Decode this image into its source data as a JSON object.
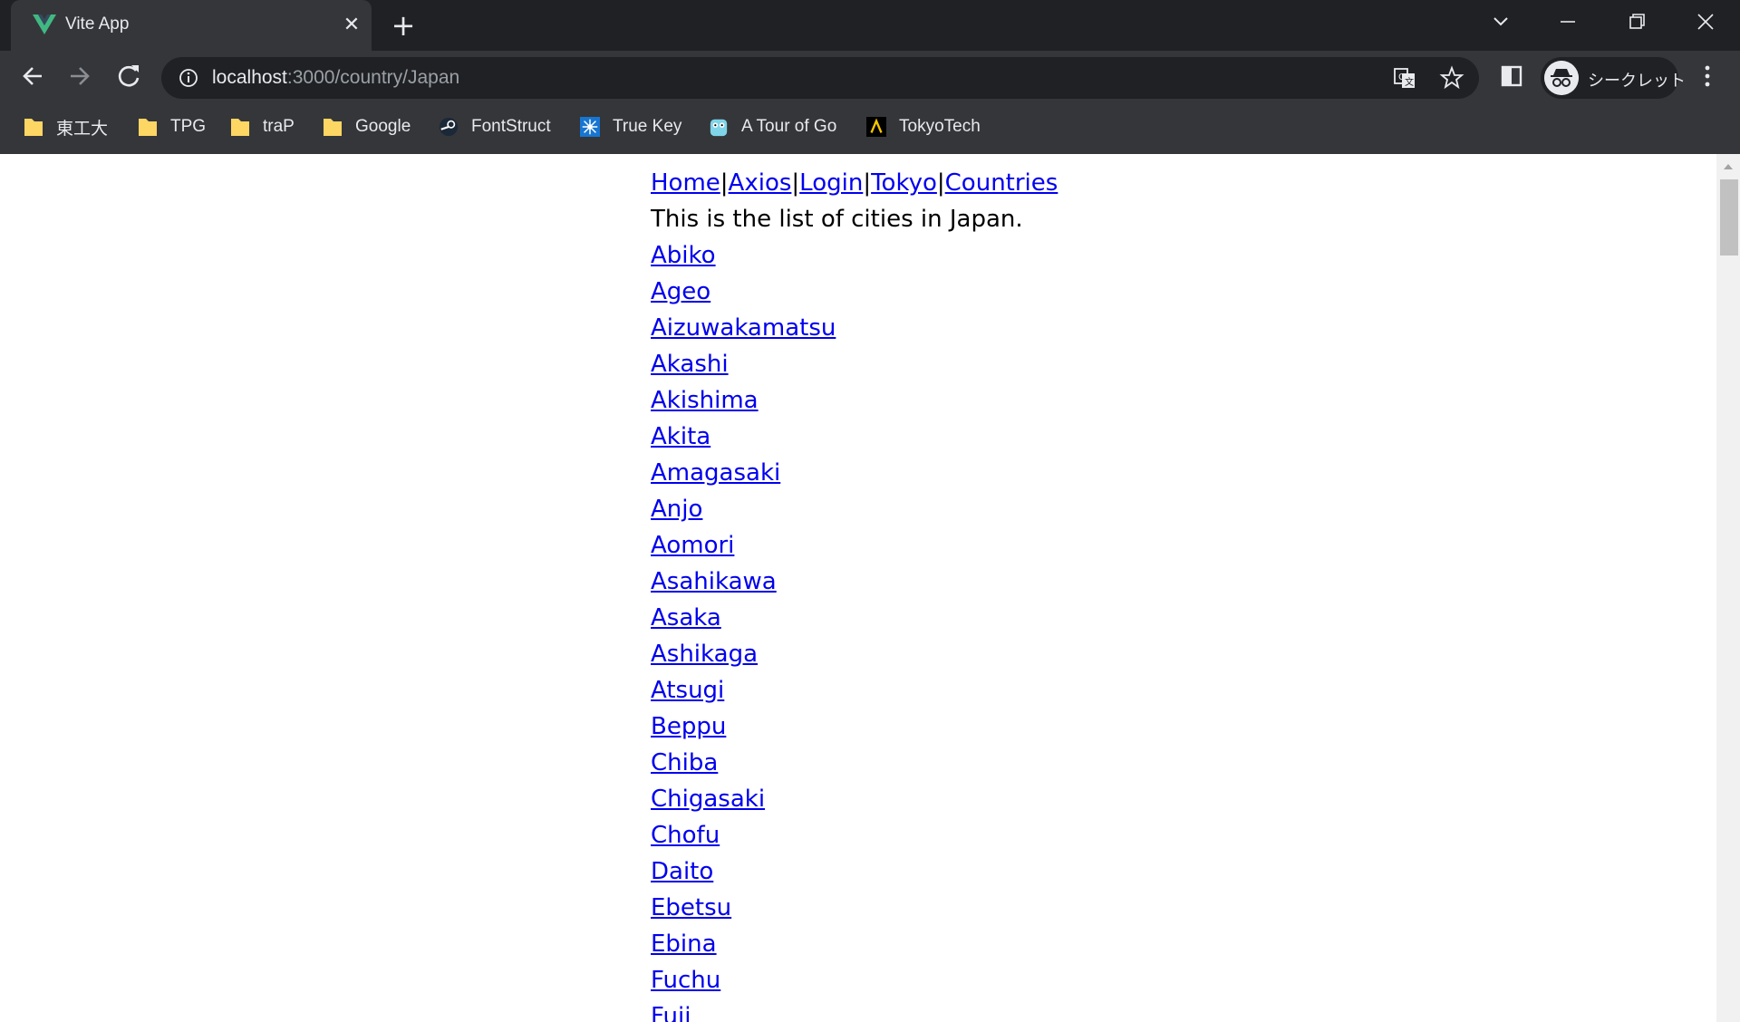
{
  "browser": {
    "tab_title": "Vite App",
    "url_host": "localhost",
    "url_path": ":3000/country/Japan",
    "profile_label": "シークレット",
    "bookmarks": [
      {
        "label": "東工大",
        "icon": "folder-icon"
      },
      {
        "label": "TPG",
        "icon": "folder-icon"
      },
      {
        "label": "traP",
        "icon": "folder-icon"
      },
      {
        "label": "Google",
        "icon": "folder-icon"
      },
      {
        "label": "FontStruct",
        "icon": "steam-icon"
      },
      {
        "label": "True Key",
        "icon": "true-key-icon"
      },
      {
        "label": "A Tour of Go",
        "icon": "gopher-icon"
      },
      {
        "label": "TokyoTech",
        "icon": "tokyotech-icon"
      }
    ]
  },
  "page": {
    "nav": [
      "Home",
      "Axios",
      "Login",
      "Tokyo",
      "Countries"
    ],
    "separator": "|",
    "intro": "This is the list of cities in Japan.",
    "cities": [
      "Abiko",
      "Ageo",
      "Aizuwakamatsu",
      "Akashi",
      "Akishima",
      "Akita",
      "Amagasaki",
      "Anjo",
      "Aomori",
      "Asahikawa",
      "Asaka",
      "Ashikaga",
      "Atsugi",
      "Beppu",
      "Chiba",
      "Chigasaki",
      "Chofu",
      "Daito",
      "Ebetsu",
      "Ebina",
      "Fuchu",
      "Fuji"
    ]
  },
  "colors": {
    "link": "#0000ee",
    "chrome_bg": "#35363a",
    "tabstrip_bg": "#202124",
    "vue_green": "#41b883"
  }
}
